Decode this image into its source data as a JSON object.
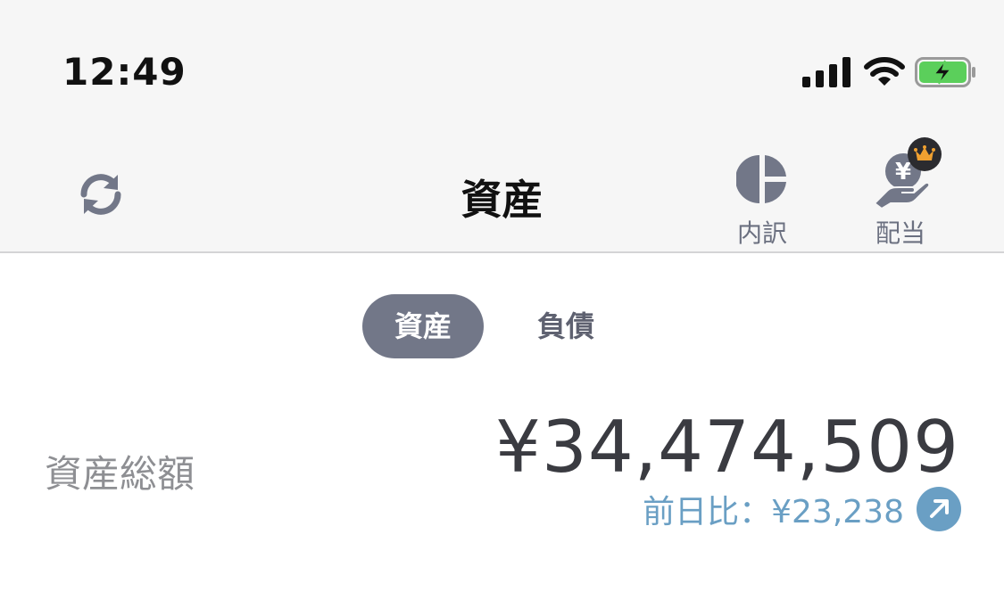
{
  "status_bar": {
    "time": "12:49",
    "icons": [
      "cellular-signal-icon",
      "wifi-icon",
      "battery-charging-icon"
    ]
  },
  "nav": {
    "title": "資産",
    "left_icon": "refresh-icon",
    "actions": [
      {
        "label": "内訳",
        "icon": "pie-chart-icon"
      },
      {
        "label": "配当",
        "icon": "hand-yen-icon",
        "badge_icon": "crown-icon"
      }
    ]
  },
  "segment": {
    "items": [
      {
        "label": "資産",
        "selected": true
      },
      {
        "label": "負債",
        "selected": false
      }
    ]
  },
  "summary": {
    "label": "資産総額",
    "value": "¥34,474,509",
    "change_text": "前日比：¥23,238",
    "change_icon": "arrow-up-right-icon"
  },
  "colors": {
    "accent_gray": "#727788",
    "change_blue": "#6a9fc4",
    "crown_orange": "#f0a030",
    "battery_green": "#5bcf5b"
  }
}
